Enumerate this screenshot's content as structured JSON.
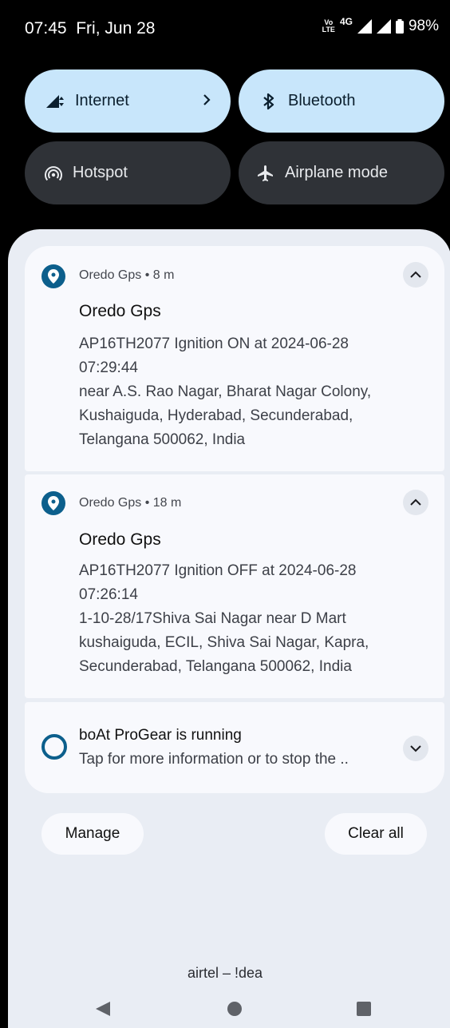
{
  "status_bar": {
    "time": "07:45",
    "date": "Fri, Jun 28",
    "volte_top": "Vo",
    "volte_bottom": "LTE",
    "network": "4G",
    "battery": "98%"
  },
  "quick_settings": [
    {
      "label": "Internet",
      "icon": "signal-icon",
      "state": "on",
      "has_chevron": true
    },
    {
      "label": "Bluetooth",
      "icon": "bluetooth-icon",
      "state": "on"
    },
    {
      "label": "Hotspot",
      "icon": "hotspot-icon",
      "state": "off"
    },
    {
      "label": "Airplane mode",
      "icon": "airplane-icon",
      "state": "off"
    }
  ],
  "notifications": [
    {
      "app": "Oredo Gps",
      "time": "8 m",
      "meta": "Oredo Gps • 8 m",
      "title": "Oredo Gps",
      "lines": [
        "AP16TH2077 Ignition ON at 2024-06-28",
        "07:29:44",
        "near A.S. Rao Nagar, Bharat Nagar Colony,",
        "Kushaiguda, Hyderabad, Secunderabad,",
        "Telangana 500062, India"
      ]
    },
    {
      "app": "Oredo Gps",
      "time": "18 m",
      "meta": "Oredo Gps • 18 m",
      "title": "Oredo Gps",
      "lines": [
        "AP16TH2077 Ignition OFF at 2024-06-28",
        "07:26:14",
        "1-10-28/17Shiva Sai Nagar near D Mart",
        "kushaiguda, ECIL, Shiva Sai Nagar, Kapra,",
        "Secunderabad, Telangana 500062, India"
      ]
    },
    {
      "title": "boAt ProGear is running",
      "text": "Tap for more information or to stop the .."
    }
  ],
  "actions": {
    "manage": "Manage",
    "clear_all": "Clear all"
  },
  "carrier": "airtel – !dea",
  "colors": {
    "accent_tile": "#c8e6fb",
    "dark_tile": "#2f3237",
    "app_icon": "#0c5f8c",
    "shade": "#e9edf4"
  }
}
